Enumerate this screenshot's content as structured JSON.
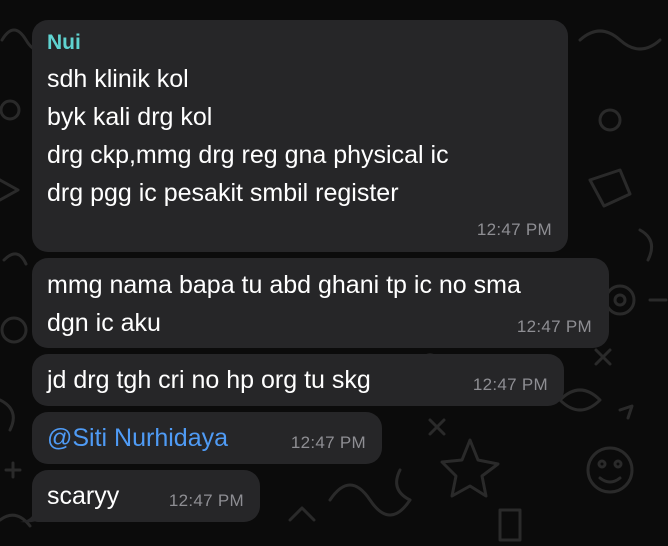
{
  "theme": {
    "background": "#0b0b0b",
    "bubble_color": "#262628",
    "sender_color": "#5fd3d0",
    "mention_color": "#4f9bf5",
    "time_color": "#8e8e93",
    "text_color": "#ffffff"
  },
  "messages": [
    {
      "sender": "Nui",
      "lines": [
        "sdh klinik kol",
        "byk kali drg kol",
        "drg ckp,mmg drg reg gna physical ic",
        "drg pgg ic pesakit smbil register"
      ],
      "time": "12:47 PM"
    },
    {
      "lines": [
        "mmg nama bapa tu abd ghani tp ic no sma",
        "dgn ic aku"
      ],
      "time": "12:47 PM"
    },
    {
      "lines": [
        "jd drg tgh cri no hp org tu skg"
      ],
      "time": "12:47 PM"
    },
    {
      "mention": "@Siti Nurhidaya",
      "time": "12:47 PM"
    },
    {
      "lines": [
        "scaryy"
      ],
      "time": "12:47 PM"
    }
  ]
}
